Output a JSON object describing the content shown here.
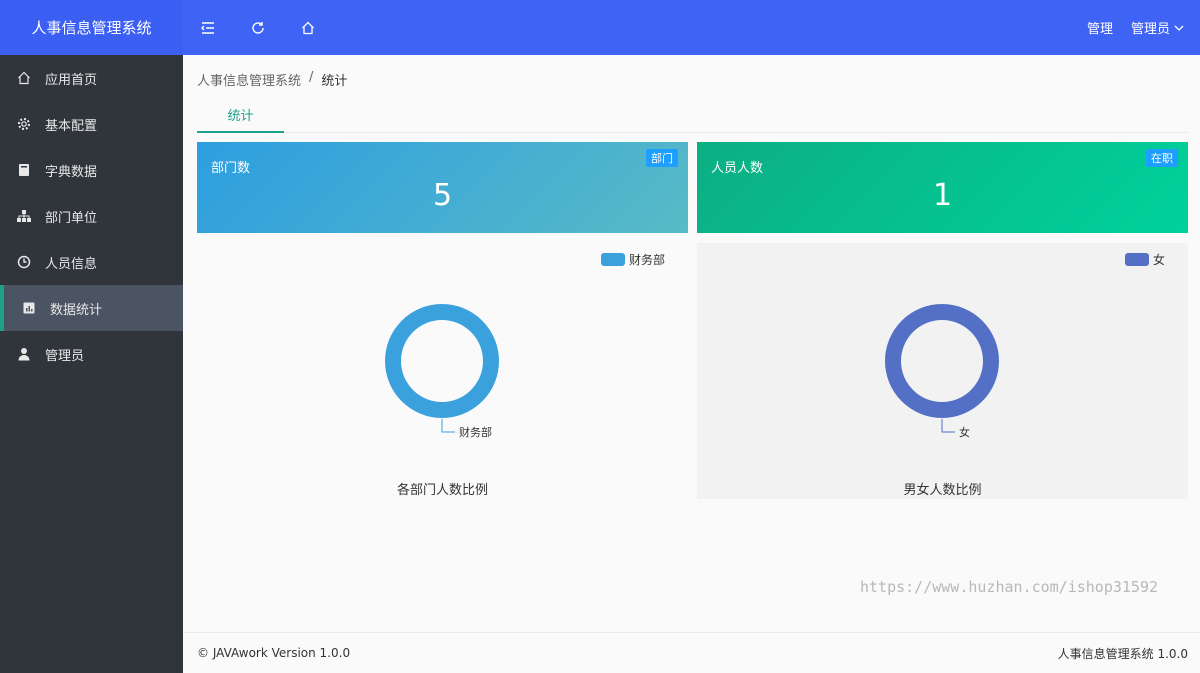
{
  "app": {
    "title": "人事信息管理系统"
  },
  "header": {
    "icons": [
      "menu-fold-icon",
      "refresh-icon",
      "home-icon"
    ],
    "manage_label": "管理",
    "user_label": "管理员"
  },
  "sidebar": {
    "items": [
      {
        "label": "应用首页",
        "icon": "home-icon"
      },
      {
        "label": "基本配置",
        "icon": "gear-icon"
      },
      {
        "label": "字典数据",
        "icon": "book-icon"
      },
      {
        "label": "部门单位",
        "icon": "org-chart-icon"
      },
      {
        "label": "人员信息",
        "icon": "clock-icon"
      },
      {
        "label": "数据统计",
        "icon": "chart-icon",
        "active": true
      },
      {
        "label": "管理员",
        "icon": "user-icon"
      }
    ]
  },
  "breadcrumb": {
    "root": "人事信息管理系统",
    "sep": "/",
    "current": "统计"
  },
  "tabs": [
    {
      "label": "统计"
    }
  ],
  "cards": [
    {
      "title": "部门数",
      "badge": "部门",
      "value": "5"
    },
    {
      "title": "人员人数",
      "badge": "在职",
      "value": "1"
    }
  ],
  "chart_data": [
    {
      "type": "pie",
      "title": "各部门人数比例",
      "categories": [
        "财务部"
      ],
      "values": [
        1
      ],
      "colors": [
        "#3aa1dc"
      ],
      "legend": "top-right"
    },
    {
      "type": "pie",
      "title": "男女人数比例",
      "categories": [
        "女"
      ],
      "values": [
        1
      ],
      "colors": [
        "#5470c6"
      ],
      "legend": "top-right"
    }
  ],
  "watermark": "https://www.huzhan.com/ishop31592",
  "footer": {
    "left": "© JAVAwork Version 1.0.0",
    "right": "人事信息管理系统 1.0.0"
  },
  "colors": {
    "header": "#3f64f5",
    "sidebar": "#2f353b",
    "accent": "#1ea08b"
  }
}
